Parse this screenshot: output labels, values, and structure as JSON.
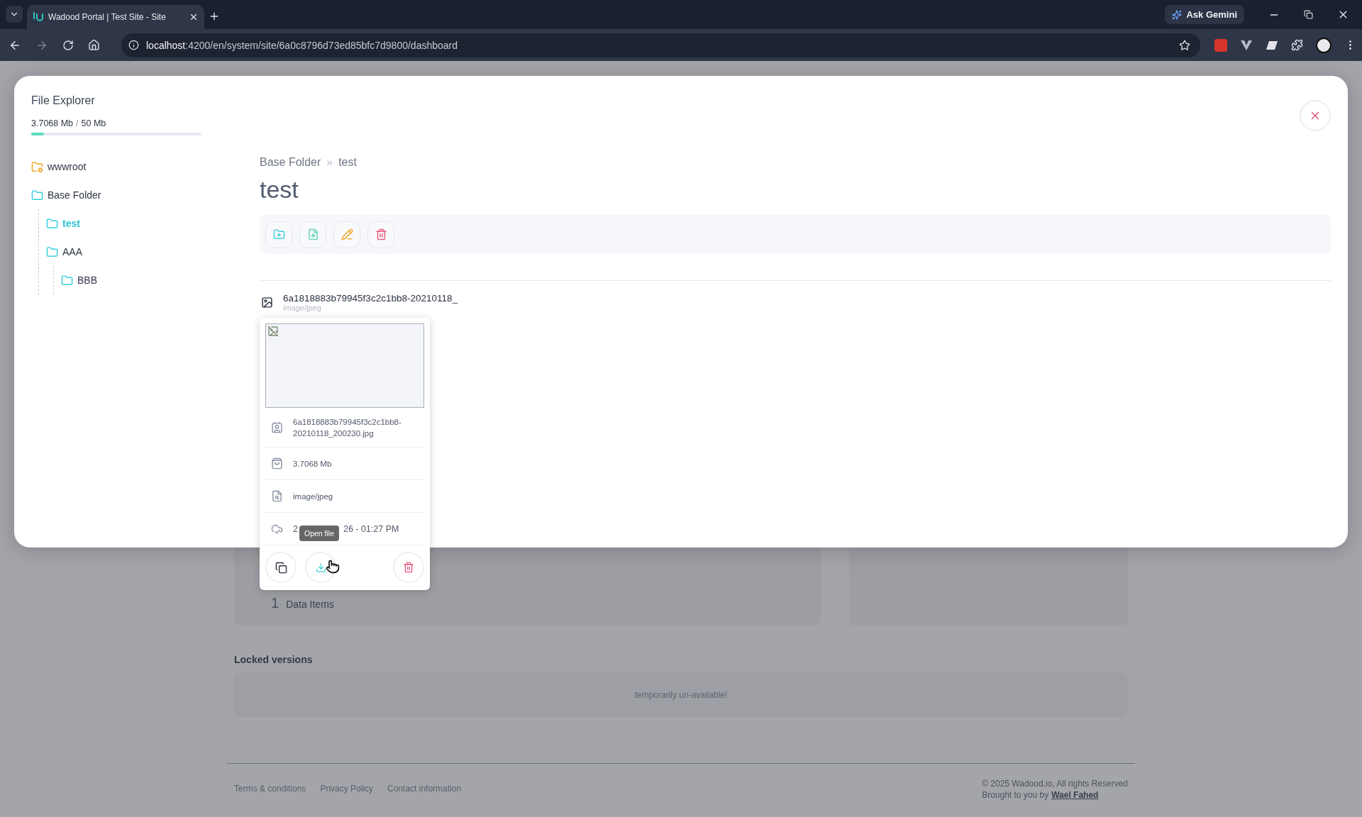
{
  "browser": {
    "tab_title": "Wadood Portal | Test Site - Site",
    "url_host": "localhost",
    "url_path": ":4200/en/system/site/6a0c8796d73ed85bfc7d9800/dashboard",
    "gemini_label": "Ask Gemini"
  },
  "explorer": {
    "title": "File Explorer",
    "usage": {
      "used": "3.7068 Mb",
      "separator": "/",
      "total": "50 Mb",
      "level": 0.075
    },
    "tree": [
      {
        "label": "wwwroot",
        "kind": "system",
        "selected": false
      },
      {
        "label": "Base Folder",
        "kind": "folder",
        "selected": false,
        "children": [
          {
            "label": "test",
            "kind": "folder",
            "selected": true
          },
          {
            "label": "AAA",
            "kind": "folder",
            "selected": false,
            "children": [
              {
                "label": "BBB",
                "kind": "folder",
                "selected": false
              }
            ]
          }
        ]
      }
    ],
    "breadcrumb": [
      "Base Folder",
      "test"
    ],
    "breadcrumb_separator": "»",
    "heading": "test",
    "toolbar": [
      {
        "kind": "new-folder"
      },
      {
        "kind": "upload"
      },
      {
        "kind": "rename"
      },
      {
        "kind": "delete"
      }
    ],
    "files": [
      {
        "name": "6a1818883b79945f3c2c1bb8-20210118_",
        "type": "image/jpeg"
      }
    ],
    "details": {
      "rows": [
        {
          "kind": "name",
          "text": "6a1818883b79945f3c2c1bb8-20210118_200230.jpg"
        },
        {
          "kind": "size",
          "text": "3.7068 Mb"
        },
        {
          "kind": "type",
          "text": "image/jpeg"
        },
        {
          "kind": "date",
          "text": "2",
          "text_end": "26 - 01:27 PM"
        }
      ],
      "actions": [
        {
          "kind": "copy"
        },
        {
          "kind": "download"
        },
        {
          "kind": "delete"
        }
      ],
      "tooltip": "Open file"
    }
  },
  "page": {
    "stat_value": "1",
    "stat_label": "Data Items",
    "locked_title": "Locked versions",
    "locked_message": "temporarily un-available!",
    "footer": {
      "links": [
        "Terms & conditions",
        "Privacy Policy",
        "Contact information"
      ],
      "copyright": "© 2025 Wadood.io, All rights Reserved",
      "credit_prefix": "Brought to you by",
      "credit_link": "Wael Fahed"
    }
  }
}
